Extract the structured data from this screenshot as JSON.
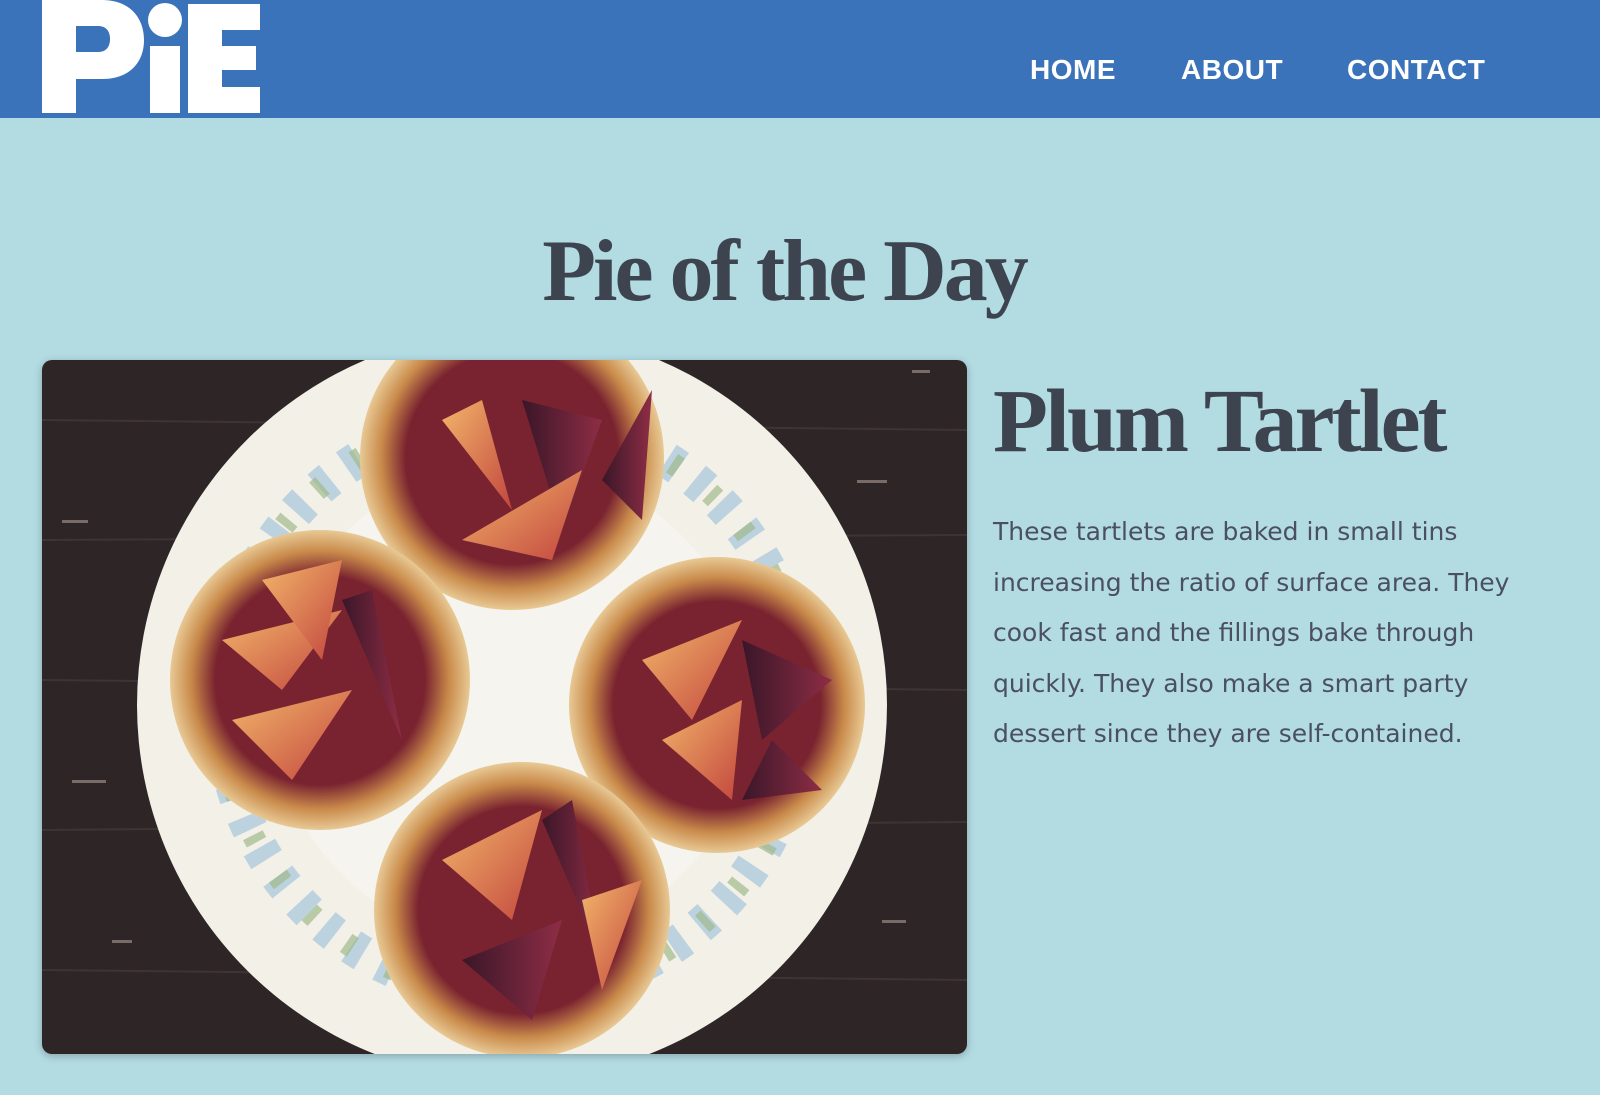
{
  "header": {
    "logo_text": "PiE",
    "nav": [
      {
        "label": "HOME"
      },
      {
        "label": "ABOUT"
      },
      {
        "label": "CONTACT"
      }
    ]
  },
  "main": {
    "section_title": "Pie of the Day",
    "pie": {
      "name": "Plum Tartlet",
      "description": "These tartlets are baked in small tins increasing the ratio of surface area. They cook fast and the fillings bake through quickly. They also make a smart party dessert since they are self-contained."
    }
  },
  "colors": {
    "header_bg": "#3a73b9",
    "page_bg": "#b2dbe2",
    "heading_text": "#3d4450",
    "body_text": "#4a5060"
  }
}
